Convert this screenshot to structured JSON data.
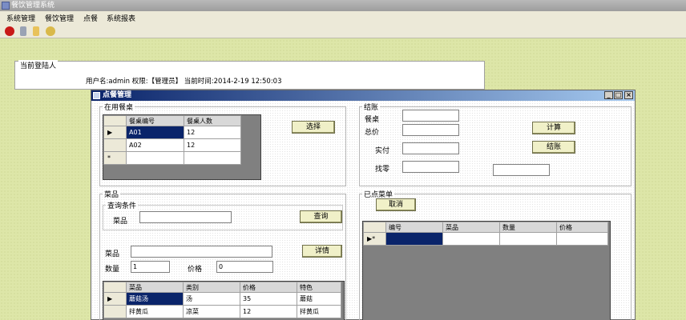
{
  "app": {
    "title": "餐饮管理系统"
  },
  "menu": [
    "系统管理",
    "餐饮管理",
    "点餐",
    "系统报表"
  ],
  "login": {
    "legend": "当前登陆人",
    "info": "用户名:admin 权限:【管理员】 当前时间:2014-2-19 12:50:03"
  },
  "window": {
    "title": "点餐管理",
    "min": "_",
    "max": "□",
    "close": "×"
  },
  "in_use": {
    "legend": "在用餐桌",
    "columns": [
      "餐桌编号",
      "餐桌人数"
    ],
    "rows": [
      {
        "marker": "▶",
        "code": "A01",
        "count": "12"
      },
      {
        "marker": "",
        "code": "A02",
        "count": "12"
      },
      {
        "marker": "*",
        "code": "",
        "count": ""
      }
    ],
    "select_button": "选择"
  },
  "checkout": {
    "legend": "结账",
    "table_label": "餐桌",
    "total_label": "总价",
    "paid_label": "实付",
    "change_label": "找零",
    "table_value": "",
    "total_value": "",
    "paid_value": "",
    "change_value": "",
    "extra_value": "",
    "calc_button": "计算",
    "checkout_button": "结账"
  },
  "dishes": {
    "legend": "菜品",
    "query_legend": "查询条件",
    "query_label": "菜品",
    "query_value": "",
    "query_button": "查询",
    "dish_label": "菜品",
    "dish_value": "",
    "detail_button": "详情",
    "qty_label": "数量",
    "qty_value": "1",
    "price_label": "价格",
    "price_value": "0",
    "columns": [
      "菜品",
      "类别",
      "价格",
      "特色"
    ],
    "rows": [
      {
        "marker": "▶",
        "name": "蘑菇汤",
        "type": "汤",
        "price": "35",
        "feature": "蘑菇"
      },
      {
        "marker": "",
        "name": "拌黄瓜",
        "type": "凉菜",
        "price": "12",
        "feature": "拌黄瓜"
      }
    ]
  },
  "ordered": {
    "legend": "已点菜单",
    "cancel_button": "取消",
    "columns": [
      "编号",
      "菜品",
      "数量",
      "价格"
    ],
    "new_row_marker": "▶*"
  }
}
